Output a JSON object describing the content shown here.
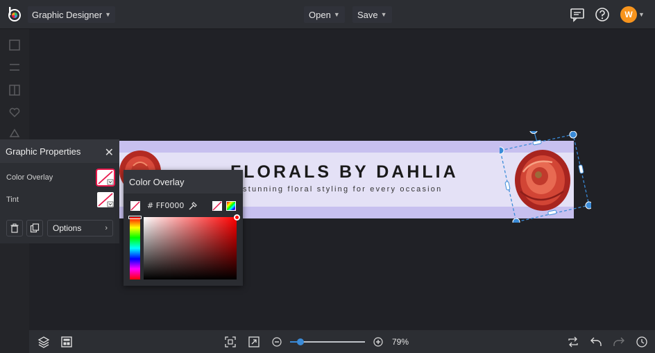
{
  "header": {
    "mode_label": "Graphic Designer",
    "open_label": "Open",
    "save_label": "Save",
    "user_initial": "W"
  },
  "banner": {
    "title": "FLORALS BY DAHLIA",
    "subtitle": "stunning floral styling for every occasion",
    "colors": {
      "outer": "#c7c0ef",
      "inner": "#e4e1f6"
    }
  },
  "graphic_properties": {
    "title": "Graphic Properties",
    "color_overlay_label": "Color Overlay",
    "tint_label": "Tint",
    "options_label": "Options"
  },
  "color_overlay": {
    "title": "Color Overlay",
    "hex_prefix": "#",
    "hex_value": "FF0000",
    "selected_color": "#ff0000"
  },
  "footer": {
    "zoom_level": "79%"
  },
  "colors": {
    "accent": "#3a8bd8",
    "selection_border": "#e8184c",
    "avatar": "#f7941d"
  }
}
